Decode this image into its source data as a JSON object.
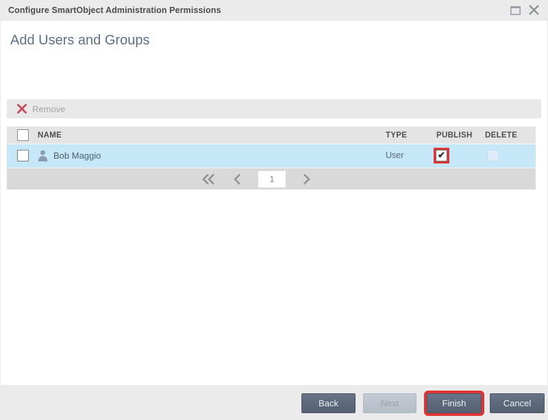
{
  "window": {
    "title": "Configure SmartObject Administration Permissions"
  },
  "page": {
    "heading": "Add Users and Groups"
  },
  "toolbar": {
    "remove_label": "Remove",
    "remove_enabled": false
  },
  "table": {
    "columns": [
      "NAME",
      "TYPE",
      "PUBLISH",
      "DELETE"
    ],
    "check_glyph": "✔",
    "rows": [
      {
        "name": "Bob Maggio",
        "type": "User",
        "row_checkbox_checked": false,
        "publish_checked": true,
        "delete_checked": false,
        "highlighted": true,
        "icon": "user-icon"
      }
    ]
  },
  "pagination": {
    "current_page": "1",
    "icons": [
      "first-page-icon",
      "previous-page-icon",
      "next-page-icon"
    ]
  },
  "footer": {
    "back_label": "Back",
    "next_label": "Next",
    "finish_label": "Finish",
    "cancel_label": "Cancel",
    "next_enabled": false
  },
  "annotations": {
    "highlight_color": "#e13434",
    "highlighted_elements": [
      "publish-checkbox",
      "finish-button"
    ]
  },
  "colors": {
    "titlebar_bg": "#ebebeb",
    "heading_text": "#5d7087",
    "row_highlight": "#c5e7f8",
    "table_header_bg": "#e4e4e4",
    "pager_bg": "#d9d9d9",
    "footer_bg": "#ebebeb",
    "button_dark": "#5b6879",
    "remove_x": "#c4515c"
  }
}
